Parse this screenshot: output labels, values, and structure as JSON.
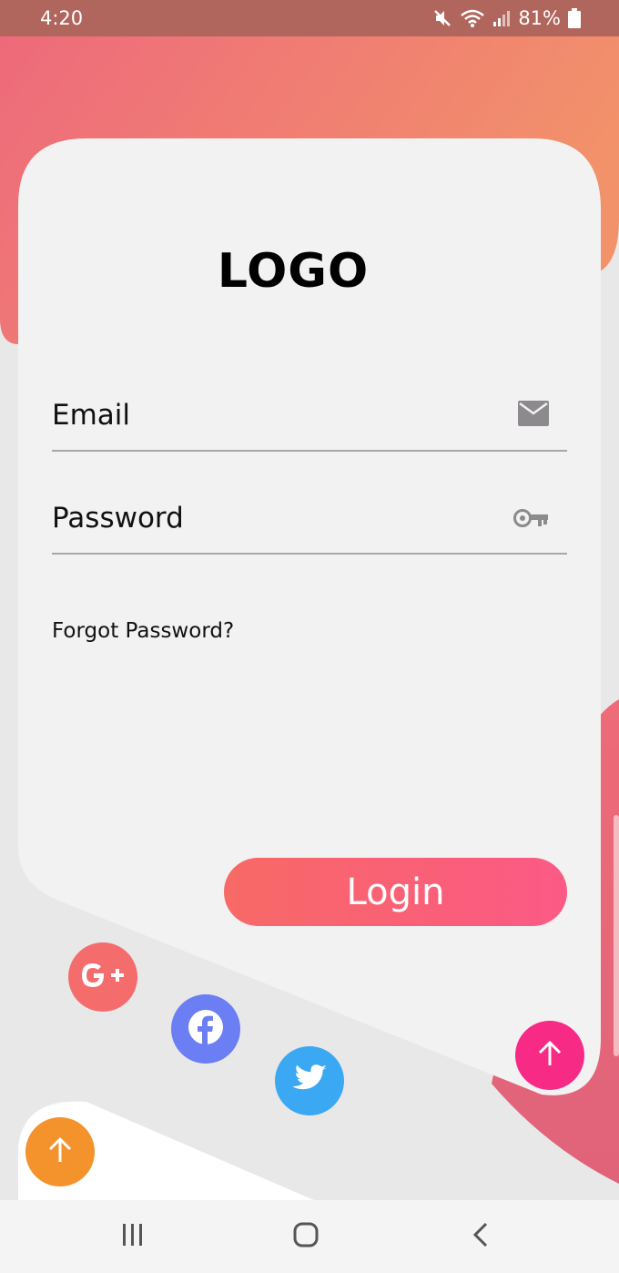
{
  "status_bar": {
    "time": "4:20",
    "battery": "81%",
    "icons": [
      "mute-icon",
      "wifi-icon",
      "signal-icon",
      "battery-icon"
    ]
  },
  "login_card": {
    "logo": "LOGO",
    "email": {
      "label": "Email",
      "icon": "mail-icon"
    },
    "password": {
      "label": "Password",
      "icon": "key-icon"
    },
    "forgot_password": "Forgot Password?",
    "login_button": "Login"
  },
  "social": [
    {
      "name": "google-plus",
      "icon": "google-plus-icon",
      "color": "#f56c6c"
    },
    {
      "name": "facebook",
      "icon": "facebook-icon",
      "color": "#6b7ef3"
    },
    {
      "name": "twitter",
      "icon": "twitter-icon",
      "color": "#3aa8f2"
    }
  ],
  "floating_buttons": [
    {
      "icon": "arrow-up-icon",
      "color": "#f72a86"
    },
    {
      "icon": "arrow-up-icon",
      "color": "#f4922b"
    }
  ],
  "nav_bar": {
    "icons": [
      "recent-apps-icon",
      "home-icon",
      "back-icon"
    ]
  },
  "colors": {
    "gradient_start": "#ef6b7a",
    "gradient_end": "#f28e6a",
    "card": "#f3f2f3",
    "background": "#e9e8e9"
  }
}
